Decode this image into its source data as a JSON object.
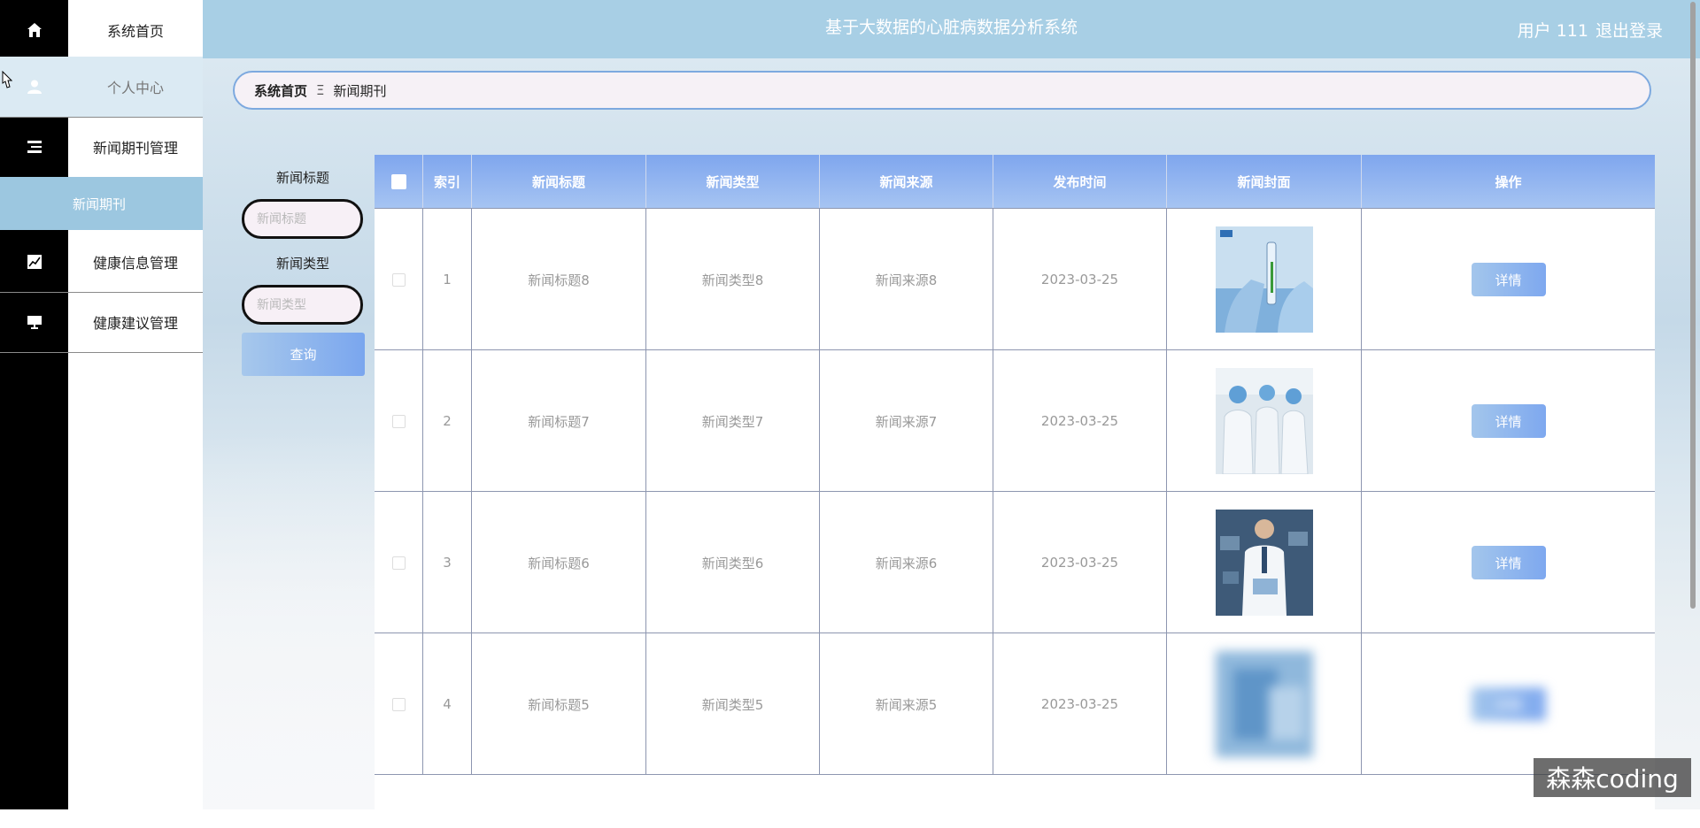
{
  "header": {
    "title": "基于大数据的心脏病数据分析系统",
    "user_label": "用户 111",
    "logout_label": "退出登录"
  },
  "sidebar": {
    "items": [
      {
        "label": "系统首页",
        "icon": "home-icon"
      },
      {
        "label": "个人中心",
        "icon": "user-icon"
      },
      {
        "label": "新闻期刊管理",
        "icon": "list-icon"
      },
      {
        "label": "健康信息管理",
        "icon": "chart-icon"
      },
      {
        "label": "健康建议管理",
        "icon": "monitor-icon"
      }
    ],
    "submenu_active": "新闻期刊"
  },
  "breadcrumb": {
    "home": "系统首页",
    "separator": "Ξ",
    "current": "新闻期刊"
  },
  "search": {
    "title_label": "新闻标题",
    "title_placeholder": "新闻标题",
    "type_label": "新闻类型",
    "type_placeholder": "新闻类型",
    "query_label": "查询"
  },
  "table": {
    "columns": [
      "索引",
      "新闻标题",
      "新闻类型",
      "新闻来源",
      "发布时间",
      "新闻封面",
      "操作"
    ],
    "rows": [
      {
        "index": "1",
        "title": "新闻标题8",
        "type": "新闻类型8",
        "source": "新闻来源8",
        "date": "2023-03-25",
        "action": "详情"
      },
      {
        "index": "2",
        "title": "新闻标题7",
        "type": "新闻类型7",
        "source": "新闻来源7",
        "date": "2023-03-25",
        "action": "详情"
      },
      {
        "index": "3",
        "title": "新闻标题6",
        "type": "新闻类型6",
        "source": "新闻来源6",
        "date": "2023-03-25",
        "action": "详情"
      },
      {
        "index": "4",
        "title": "新闻标题5",
        "type": "新闻类型5",
        "source": "新闻来源5",
        "date": "2023-03-25",
        "action": "详情"
      }
    ]
  },
  "watermark": "森森coding",
  "colors": {
    "header_bg": "#a8cfe5",
    "active_submenu": "#9cc7e0",
    "table_header": "#7fa6ee",
    "button": "#7ea8ef"
  }
}
